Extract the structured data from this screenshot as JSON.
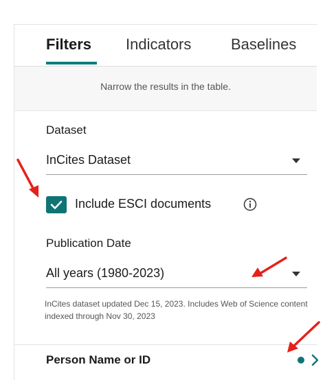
{
  "tabs": [
    {
      "label": "Filters",
      "active": true
    },
    {
      "label": "Indicators",
      "active": false
    },
    {
      "label": "Baselines",
      "active": false
    }
  ],
  "hint": "Narrow the results in the table.",
  "dataset": {
    "label": "Dataset",
    "value": "InCites Dataset"
  },
  "esci": {
    "label": "Include ESCI documents",
    "checked": true
  },
  "publication_date": {
    "label": "Publication Date",
    "value": "All years (1980-2023)"
  },
  "note": "InCites dataset updated Dec 15, 2023. Includes Web of Science content indexed through Nov 30, 2023",
  "person_filter": {
    "label": "Person Name or ID"
  },
  "colors": {
    "accent": "#0f7474",
    "annotation_arrow": "#e6201a"
  },
  "icons": [
    "check-icon",
    "info-icon",
    "caret-down-icon",
    "status-dot",
    "chevron-right-icon",
    "red-arrow-annotation"
  ]
}
